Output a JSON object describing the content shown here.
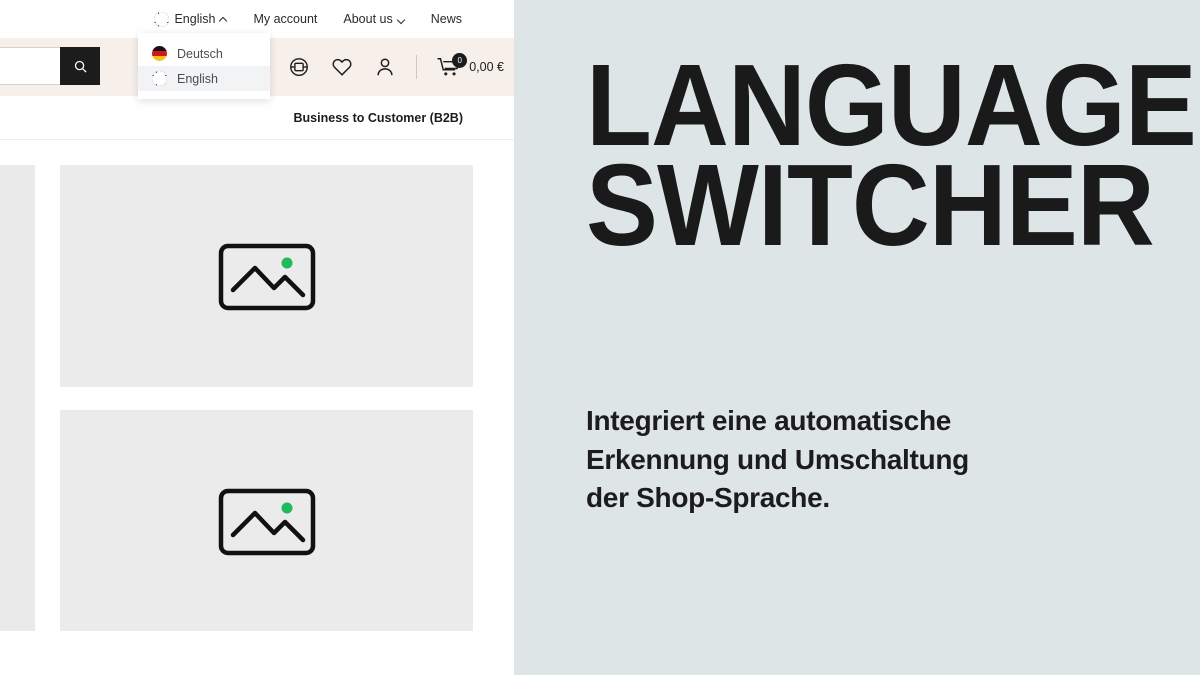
{
  "shop": {
    "topnav": {
      "language_switcher": {
        "label": "English",
        "flag": "uk-flag-icon",
        "caret": "chevron-up-icon"
      },
      "items": [
        {
          "label": "My account",
          "has_caret": false
        },
        {
          "label": "About us",
          "has_caret": true
        },
        {
          "label": "News",
          "has_caret": false
        }
      ]
    },
    "language_menu": {
      "options": [
        {
          "label": "Deutsch",
          "flag": "de-flag-icon",
          "selected": false
        },
        {
          "label": "English",
          "flag": "uk-flag-icon",
          "selected": true
        }
      ]
    },
    "header": {
      "search": {
        "value": "",
        "placeholder": "",
        "button_icon": "search-icon"
      },
      "icons": [
        {
          "name": "compare-icon"
        },
        {
          "name": "wishlist-heart-icon"
        },
        {
          "name": "account-person-icon"
        }
      ],
      "cart": {
        "icon": "shopping-cart-icon",
        "badge_count": "0",
        "total": "0,00 €"
      }
    },
    "b2b_row": {
      "label": "Business to Customer (B2B)"
    },
    "placeholders": {
      "icon": "image-placeholder-icon",
      "accent_color": "#21ba5b"
    }
  },
  "promo": {
    "title_line_1": "LANGUAGE",
    "title_line_2": "SWITCHER",
    "subtitle_line_1": "Integriert eine automatische",
    "subtitle_line_2": "Erkennung und Umschaltung",
    "subtitle_line_3": "der Shop-Sprache.",
    "background_color": "#dde5e7",
    "text_color": "#1a1a1a"
  }
}
